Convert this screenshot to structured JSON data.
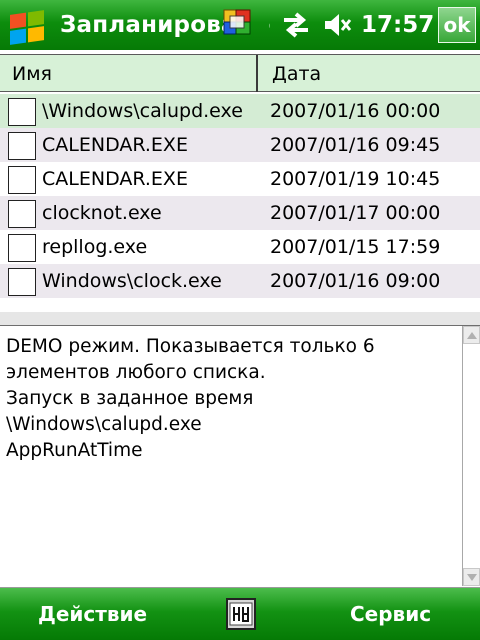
{
  "titlebar": {
    "title": "Запланирова",
    "title_suffix": "е",
    "clock": "17:57",
    "ok_label": "ok",
    "icons": {
      "start": "windows-flag-icon",
      "sync": "activesync-icon",
      "connectivity": "connectivity-arrows-icon",
      "volume": "volume-muted-icon"
    }
  },
  "list": {
    "columns": [
      "Имя",
      "Дата"
    ],
    "rows": [
      {
        "name": "\\Windows\\calupd.exe",
        "date": "2007/01/16 00:00",
        "selected": true
      },
      {
        "name": "CALENDAR.EXE",
        "date": "2007/01/16 09:45",
        "selected": false
      },
      {
        "name": "CALENDAR.EXE",
        "date": "2007/01/19 10:45",
        "selected": false
      },
      {
        "name": "clocknot.exe",
        "date": "2007/01/17 00:00",
        "selected": false
      },
      {
        "name": "repllog.exe",
        "date": "2007/01/15 17:59",
        "selected": false
      },
      {
        "name": "Windows\\clock.exe",
        "date": "2007/01/16 09:00",
        "selected": false
      }
    ]
  },
  "details": {
    "lines": [
      "DEMO режим. Показывается только 6",
      "элементов любого списка.",
      "Запуск в заданное время",
      "\\Windows\\calupd.exe",
      "AppRunAtTime"
    ]
  },
  "menubar": {
    "left": "Действие",
    "right": "Сервис",
    "sip_icon": "keyboard-sip-icon"
  },
  "colors": {
    "bar_green": "#0d8d0d",
    "header_green": "#d7f1d7",
    "selected_row": "#d4ecd4",
    "alt_row": "#ece8ee"
  }
}
